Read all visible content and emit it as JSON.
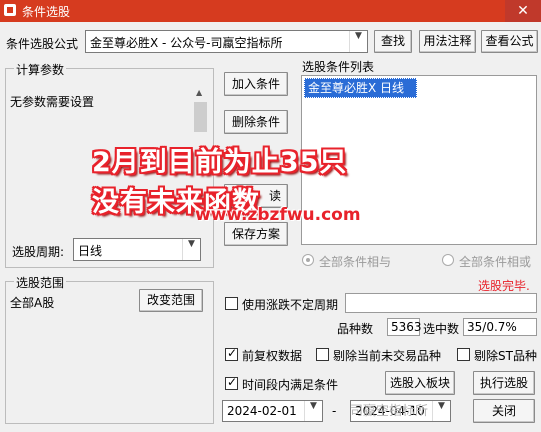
{
  "window": {
    "title": "条件选股",
    "close": "✕"
  },
  "formula": {
    "label": "条件选股公式",
    "value": "金至尊必胜X  -  公众号-司蠃空指标所",
    "find": "查找",
    "usage": "用法注释",
    "view": "查看公式"
  },
  "params": {
    "group_title": "计算参数",
    "text": "无参数需要设置"
  },
  "actions": {
    "add": "加入条件",
    "delete": "删除条件",
    "read": "读",
    "save": "保存方案"
  },
  "cond_list": {
    "title": "选股条件列表",
    "items": [
      "金至尊必胜X  日线"
    ]
  },
  "period": {
    "label": "选股周期:",
    "value": "日线"
  },
  "logic": {
    "and": "全部条件相与",
    "or": "全部条件相或"
  },
  "status": {
    "text": "选股完毕.",
    "color": "#e8222b"
  },
  "range": {
    "group_title": "选股范围",
    "value": "全部A股",
    "change": "改变范围"
  },
  "options": {
    "use_period": "使用涨跌不定周期",
    "count_label": "品种数",
    "count_value": "5363",
    "selected_label": "选中数",
    "selected_value": "35/0.7%",
    "forward_adjust": "前复权数据",
    "exclude_untraded": "剔除当前未交易品种",
    "exclude_st": "剔除ST品种",
    "time_range": "时间段内满足条件"
  },
  "buttons": {
    "to_sector": "选股入板块",
    "execute": "执行选股",
    "close": "关闭"
  },
  "dates": {
    "start": "2024-02-01",
    "separator": "-",
    "end": "2024-04-10"
  },
  "overlay": {
    "line1": "2月到目前为止35只",
    "line2": "没有未来函数",
    "site": "www.zbzfwu.com"
  },
  "watermark": "司蠃空指标所"
}
